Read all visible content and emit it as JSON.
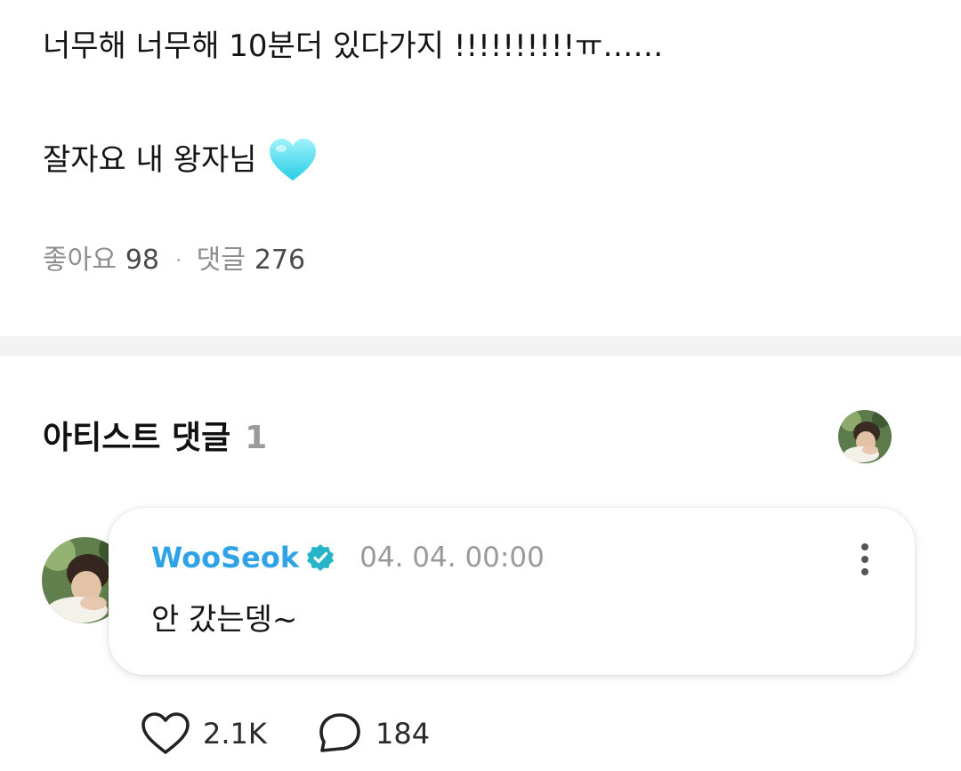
{
  "post": {
    "line1": "너무해 너무해  10분더 있다가지 !!!!!!!!!!ㅠ……",
    "line2": "잘자요 내 왕자님",
    "emoji": "light-blue-heart",
    "likes_label": "좋아요",
    "likes_count": "98",
    "separator": "·",
    "comments_label": "댓글",
    "comments_count": "276"
  },
  "artist_comments": {
    "title": "아티스트 댓글",
    "count": "1"
  },
  "comment": {
    "author": "WooSeok",
    "verified_icon": "verified-badge-icon",
    "timestamp": "04. 04. 00:00",
    "text": "안 갔는뎅~",
    "menu_icon": "more-vertical-icon",
    "like_count": "2.1K",
    "reply_count": "184"
  },
  "colors": {
    "author": "#2fa3e6",
    "verified_badge": "#27b4c8",
    "muted_text": "#8e8e8e",
    "divider": "#f2f2f2",
    "heart_emoji": "#5fe0f0"
  }
}
